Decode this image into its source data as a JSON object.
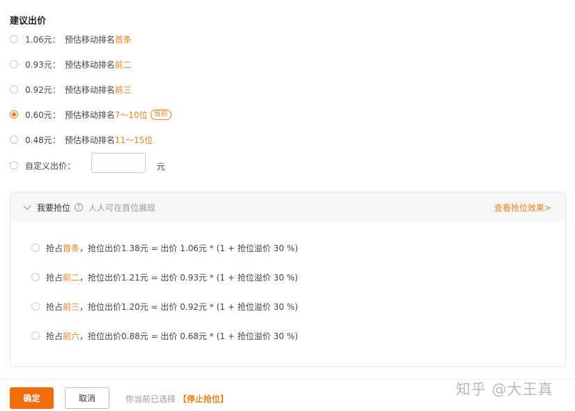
{
  "section_title": "建议出价",
  "bid_options": [
    {
      "price": "1.06元：",
      "desc": "预估移动排名",
      "rank": "首条",
      "badge": "",
      "checked": false
    },
    {
      "price": "0.93元：",
      "desc": "预估移动排名",
      "rank": "前二",
      "badge": "",
      "checked": false
    },
    {
      "price": "0.92元：",
      "desc": "预估移动排名",
      "rank": "前三",
      "badge": "",
      "checked": false
    },
    {
      "price": "0.60元：",
      "desc": "预估移动排名",
      "rank": "7～10位",
      "badge": "当前",
      "checked": true
    },
    {
      "price": "0.48元：",
      "desc": "预估移动排名",
      "rank": "11～15位",
      "badge": "",
      "checked": false
    }
  ],
  "custom_bid": {
    "label": "自定义出价：",
    "value": "",
    "unit": "元"
  },
  "grab_panel": {
    "title": "我要抢位",
    "help_icon": "?",
    "note": "人人可在首位展现",
    "effect_link": "查看抢位效果>",
    "options": [
      {
        "prefix": "抢占",
        "rank": "首条",
        "formula": "，抢位出价1.38元 = 出价 1.06元 * (1 + 抢位溢价 30 %)"
      },
      {
        "prefix": "抢占",
        "rank": "前二",
        "formula": "，抢位出价1.21元 = 出价 0.93元 * (1 + 抢位溢价 30 %)"
      },
      {
        "prefix": "抢占",
        "rank": "前三",
        "formula": "，抢位出价1.20元 = 出价 0.92元 * (1 + 抢位溢价 30 %)"
      },
      {
        "prefix": "抢占",
        "rank": "前六",
        "formula": "，抢位出价0.88元 = 出价 0.68元 * (1 + 抢位溢价 30 %)"
      }
    ]
  },
  "footer": {
    "confirm_label": "确定",
    "cancel_label": "取消",
    "status_text": "你当前已选择",
    "status_value": "【停止抢位】"
  },
  "watermark": "知乎 @大王真",
  "colors": {
    "accent": "#f06d0f",
    "highlight": "#e8821e"
  }
}
